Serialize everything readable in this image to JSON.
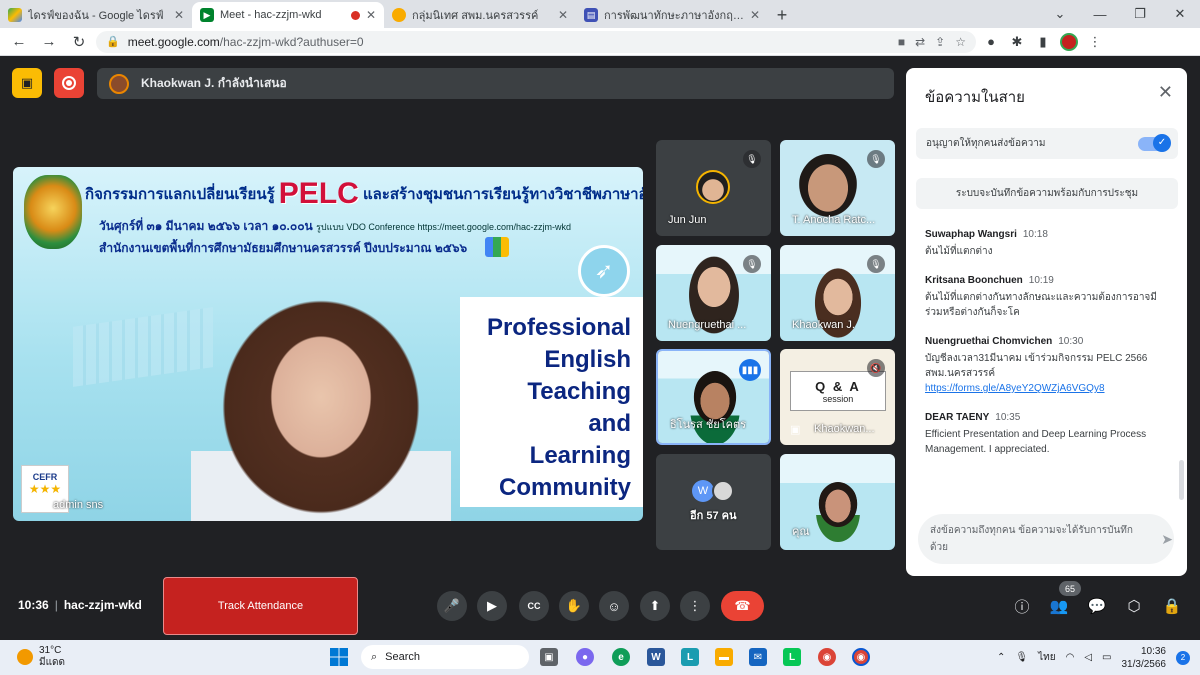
{
  "browser": {
    "tabs": [
      {
        "title": "ไดรฟ์ของฉัน - Google ไดรฟ์",
        "active": false
      },
      {
        "title": "Meet - hac-zzjm-wkd",
        "active": true
      },
      {
        "title": "กลุ่มนิเทศ สพม.นครสวรรค์",
        "active": false
      },
      {
        "title": "การพัฒนาทักษะภาษาอังกฤษ English",
        "active": false
      }
    ],
    "url_host": "meet.google.com",
    "url_path": "/hac-zzjm-wkd?authuser=0"
  },
  "meet": {
    "presenting_text": "Khaokwan J. กำลังนำเสนอ",
    "slide": {
      "title_prefix": "กิจกรรมการแลกเปลี่ยนเรียนรู้",
      "title_pelc": "PELC",
      "title_suffix": "และสร้างชุมชนการเรียนรู้ทางวิชาชีพภาษาอังกฤษ",
      "date_line": "วันศุกร์ที่ ๓๑ มีนาคม ๒๕๖๖ เวลา ๑๐.๐๐น",
      "conf_line": "รูปแบบ VDO Conference https://meet.google.com/hac-zzjm-wkd",
      "office_line": "สำนักงานเขตพื้นที่การศึกษามัธยมศึกษานครสวรรค์ ปีงบประมาณ ๒๕๖๖",
      "prof_lines": [
        "Professional",
        "English",
        "Teaching",
        "and",
        "Learning",
        "Community"
      ],
      "cefr": "CEFR",
      "presenter_name": "admin sns"
    },
    "tiles": [
      {
        "name": "Jun Jun"
      },
      {
        "name": "T. Anocha Ratc..."
      },
      {
        "name": "Nuengruethai ..."
      },
      {
        "name": "Khaokwan J."
      },
      {
        "name": "ธิโนรส ชัยโคตร"
      },
      {
        "name": "Khaokwan..."
      },
      {
        "name": "อีก 57 คน",
        "avatar_letter": "W"
      },
      {
        "name": "คุณ"
      }
    ],
    "qa_title": "Q & A",
    "qa_sub": "session",
    "meeting_time": "10:36",
    "meeting_code": "hac-zzjm-wkd",
    "attendance_label": "Track Attendance",
    "participant_count": "65"
  },
  "chat": {
    "title": "ข้อความในสาย",
    "permission_label": "อนุญาตให้ทุกคนส่งข้อความ",
    "notice": "ระบบจะบันทึกข้อความพร้อมกับการประชุม",
    "messages": [
      {
        "sender": "Suwaphap Wangsri",
        "time": "10:18",
        "text": "ต้นไม้ที่แตกต่าง"
      },
      {
        "sender": "Kritsana Boonchuen",
        "time": "10:19",
        "text": "ต้นไม้ที่แตกต่างกันทางลักษณะและความต้องการอาจมีร่วมหรือต่างกันก็จะโค"
      },
      {
        "sender": "Nuengruethai Chomvichen",
        "time": "10:30",
        "text": "บัญชีลงเวลา31มีนาคม เข้าร่วมกิจกรรม PELC 2566 สพม.นครสวรรค์",
        "link": "https://forms.gle/A8yeY2QWZjA6VGQy8"
      },
      {
        "sender": "DEAR TAENY",
        "time": "10:35",
        "text": "Efficient Presentation and Deep Learning Process Management. I appreciated."
      }
    ],
    "input_placeholder": "ส่งข้อความถึงทุกคน ข้อความจะได้รับการบันทึกด้วย"
  },
  "taskbar": {
    "temperature": "31°C",
    "weather": "มีแดด",
    "search": "Search",
    "lang": "ไทย",
    "time": "10:36",
    "date": "31/3/2566",
    "notif_count": "2"
  }
}
